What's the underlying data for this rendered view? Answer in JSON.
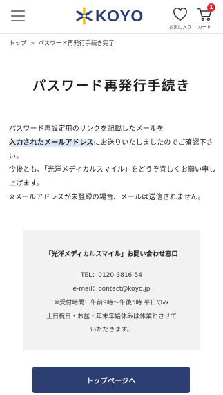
{
  "header": {
    "brand": "KOYO",
    "favorites_label": "お気に入り",
    "cart_label": "カート",
    "cart_count": "1",
    "brand_color": "#2b3f73",
    "logo_accent_color": "#f2b705",
    "badge_color": "#e5272d",
    "icons": [
      "menu-icon",
      "heart-icon",
      "cart-icon"
    ]
  },
  "breadcrumb": {
    "home": "トップ",
    "separator": ">",
    "current": "パスワード再発行手続き完了"
  },
  "page": {
    "title": "パスワード再発行手続き"
  },
  "message": {
    "line1": "パスワード再設定用のリンクを記載したメールを",
    "highlight": "入力されたメールアドレス",
    "line2_rest": "にお送りいたしましたのでご確認下さい。",
    "line3": "今後とも、「光洋メディカルスマイル」をどうぞ宜しくお願い申し上げます。",
    "line4": "※メールアドレスが未登録の場合、メールは送信されません。"
  },
  "contact": {
    "title": "「光洋メディカルスマイル」お問い合わせ窓口",
    "tel": "TEL：0120-3816-54",
    "email": "e-mail：contact@koyo.jp",
    "hours1": "※受付時間：午前9時〜午後5時 平日のみ",
    "hours2": "土日祝日・お盆・年末年始休みは休業とさせて",
    "hours3": "いただきます。"
  },
  "actions": {
    "top_page_button": "トップページへ",
    "button_color": "#2d3e73"
  }
}
